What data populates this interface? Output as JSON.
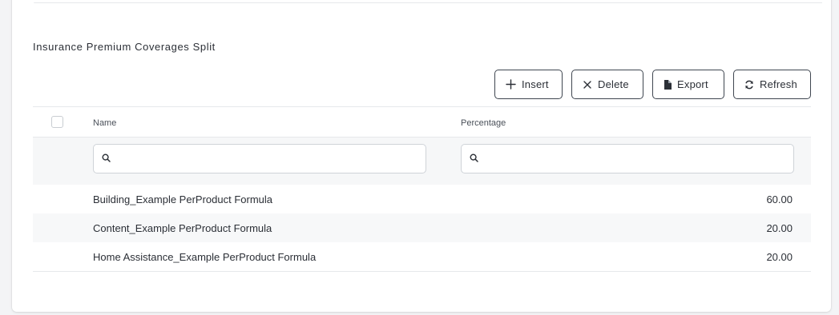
{
  "section": {
    "title": "Insurance Premium Coverages Split"
  },
  "toolbar": {
    "insert_label": "Insert",
    "delete_label": "Delete",
    "export_label": "Export",
    "refresh_label": "Refresh"
  },
  "grid": {
    "columns": {
      "name": "Name",
      "percentage": "Percentage"
    },
    "filters": {
      "name_value": "",
      "percentage_value": ""
    },
    "rows": [
      {
        "name": "Building_Example PerProduct Formula",
        "percentage": "60.00"
      },
      {
        "name": "Content_Example PerProduct Formula",
        "percentage": "20.00"
      },
      {
        "name": "Home Assistance_Example PerProduct Formula",
        "percentage": "20.00"
      }
    ]
  }
}
